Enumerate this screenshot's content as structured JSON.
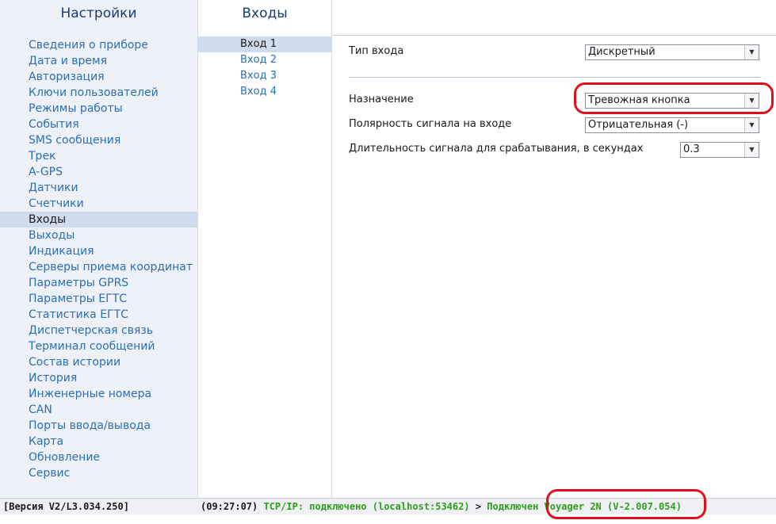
{
  "left_panel": {
    "title": "Настройки",
    "items": [
      {
        "label": "Сведения о приборе"
      },
      {
        "label": "Дата и время"
      },
      {
        "label": "Авторизация"
      },
      {
        "label": "Ключи пользователей"
      },
      {
        "label": "Режимы работы"
      },
      {
        "label": "События"
      },
      {
        "label": "SMS сообщения"
      },
      {
        "label": "Трек"
      },
      {
        "label": "A-GPS"
      },
      {
        "label": "Датчики"
      },
      {
        "label": "Счетчики"
      },
      {
        "label": "Входы"
      },
      {
        "label": "Выходы"
      },
      {
        "label": "Индикация"
      },
      {
        "label": "Серверы приема координат"
      },
      {
        "label": "Параметры GPRS"
      },
      {
        "label": "Параметры ЕГТС"
      },
      {
        "label": "Статистика ЕГТС"
      },
      {
        "label": "Диспетчерская связь"
      },
      {
        "label": "Терминал сообщений"
      },
      {
        "label": "Состав истории"
      },
      {
        "label": "История"
      },
      {
        "label": "Инженерные номера"
      },
      {
        "label": "CAN"
      },
      {
        "label": "Порты ввода/вывода"
      },
      {
        "label": "Карта"
      },
      {
        "label": "Обновление"
      },
      {
        "label": "Сервис"
      }
    ],
    "active_index": 11
  },
  "mid_panel": {
    "title": "Входы",
    "items": [
      {
        "label": "Вход 1"
      },
      {
        "label": "Вход 2"
      },
      {
        "label": "Вход 3"
      },
      {
        "label": "Вход 4"
      }
    ],
    "active_index": 0
  },
  "form": {
    "input_type": {
      "label": "Тип входа",
      "value": "Дискретный"
    },
    "purpose": {
      "label": "Назначение",
      "value": "Тревожная кнопка"
    },
    "polarity": {
      "label": "Полярность сигнала на входе",
      "value": "Отрицательная (-)"
    },
    "duration": {
      "label": "Длительность сигнала для срабатывания, в секундах",
      "value": "0.3"
    }
  },
  "status_bar": {
    "version": "[Версия V2/L3.034.250]",
    "time": "(09:27:07)",
    "tcp": "TCP/IP: подключено (localhost:53462)",
    "arrow": ">",
    "device": "Подключен Voyager 2N (V-2.007.054)"
  },
  "colors": {
    "link": "#2b6fb6",
    "active_bg": "#cfdcee",
    "status_green": "#2e9f1a",
    "highlight_red": "#e0101a"
  }
}
